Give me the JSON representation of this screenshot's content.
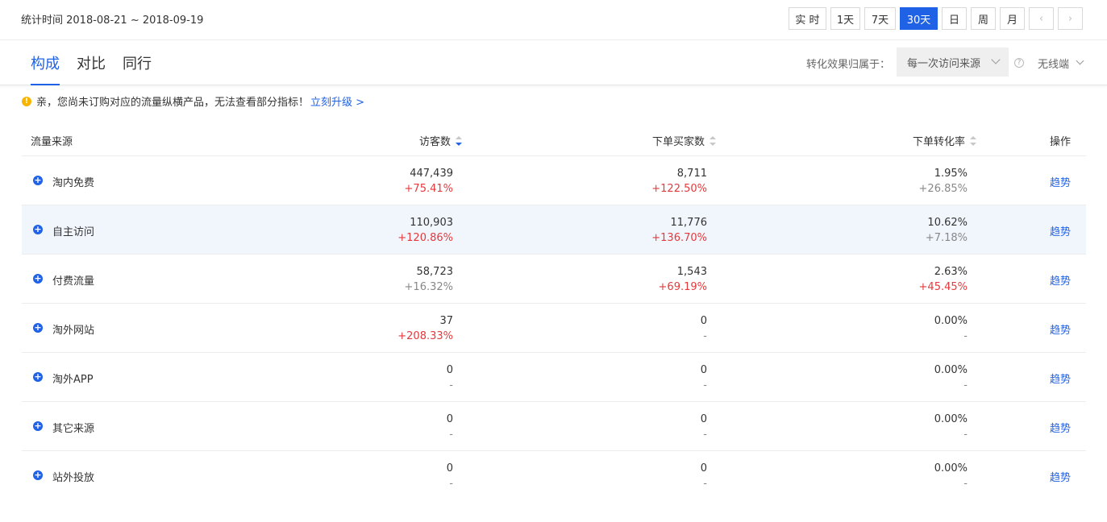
{
  "header": {
    "stat_time": "统计时间 2018-08-21 ~ 2018-09-19",
    "range_buttons": [
      "实 时",
      "1天",
      "7天",
      "30天",
      "日",
      "周",
      "月"
    ],
    "active_range": "30天",
    "prev_label": "‹",
    "next_label": "›"
  },
  "tabs": [
    "构成",
    "对比",
    "同行"
  ],
  "active_tab": "构成",
  "conversion": {
    "label": "转化效果归属于：",
    "selected": "每一次访问来源",
    "help": "?",
    "device": "无线端"
  },
  "notice": {
    "icon_glyph": "!",
    "text": "亲，您尚未订购对应的流量纵横产品，无法查看部分指标！",
    "link": "立刻升级 >"
  },
  "table": {
    "columns": {
      "source": "流量来源",
      "visitors": "访客数",
      "buyers": "下单买家数",
      "rate": "下单转化率",
      "action": "操作"
    },
    "rows": [
      {
        "name": "淘内免费",
        "visitors": "447,439",
        "visitors_change": "+75.41%",
        "buyers": "8,711",
        "buyers_change": "+122.50%",
        "rate": "1.95%",
        "rate_change": "+26.85%",
        "action": "趋势"
      },
      {
        "name": "自主访问",
        "visitors": "110,903",
        "visitors_change": "+120.86%",
        "buyers": "11,776",
        "buyers_change": "+136.70%",
        "rate": "10.62%",
        "rate_change": "+7.18%",
        "action": "趋势"
      },
      {
        "name": "付费流量",
        "visitors": "58,723",
        "visitors_change": "+16.32%",
        "buyers": "1,543",
        "buyers_change": "+69.19%",
        "rate": "2.63%",
        "rate_change": "+45.45%",
        "action": "趋势"
      },
      {
        "name": "淘外网站",
        "visitors": "37",
        "visitors_change": "+208.33%",
        "buyers": "0",
        "buyers_change": "-",
        "rate": "0.00%",
        "rate_change": "-",
        "action": "趋势"
      },
      {
        "name": "淘外APP",
        "visitors": "0",
        "visitors_change": "-",
        "buyers": "0",
        "buyers_change": "-",
        "rate": "0.00%",
        "rate_change": "-",
        "action": "趋势"
      },
      {
        "name": "其它来源",
        "visitors": "0",
        "visitors_change": "-",
        "buyers": "0",
        "buyers_change": "-",
        "rate": "0.00%",
        "rate_change": "-",
        "action": "趋势"
      },
      {
        "name": "站外投放",
        "visitors": "0",
        "visitors_change": "-",
        "buyers": "0",
        "buyers_change": "-",
        "rate": "0.00%",
        "rate_change": "-",
        "action": "趋势"
      }
    ]
  }
}
